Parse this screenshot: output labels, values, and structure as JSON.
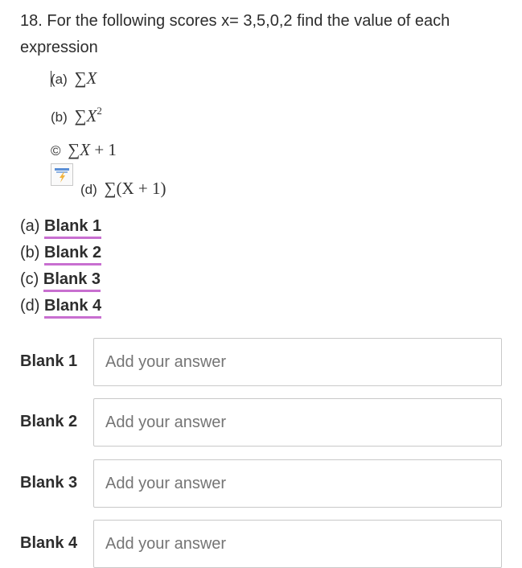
{
  "question": {
    "text": "18. For the following scores x= 3,5,0,2  find the value of each expression"
  },
  "expressions": [
    {
      "label": "(a)",
      "sum": "∑",
      "var": "X",
      "tail": ""
    },
    {
      "label": "(b)",
      "sum": "∑",
      "var": "X",
      "sup": "2",
      "tail": ""
    },
    {
      "label": "©",
      "sum": "∑",
      "var": "X",
      "tail": " + 1"
    },
    {
      "label": "(d)",
      "math": "∑(X + 1)"
    }
  ],
  "blank_refs": [
    {
      "prefix": "(a)",
      "blank": "Blank 1"
    },
    {
      "prefix": "(b)",
      "blank": "Blank 2"
    },
    {
      "prefix": "(c)",
      "blank": "Blank 3"
    },
    {
      "prefix": "(d)",
      "blank": "Blank 4"
    }
  ],
  "answers": [
    {
      "label": "Blank 1",
      "placeholder": "Add your answer",
      "value": ""
    },
    {
      "label": "Blank 2",
      "placeholder": "Add your answer",
      "value": ""
    },
    {
      "label": "Blank 3",
      "placeholder": "Add your answer",
      "value": ""
    },
    {
      "label": "Blank 4",
      "placeholder": "Add your answer",
      "value": ""
    }
  ],
  "colors": {
    "blank_underline": "#c86fd0",
    "input_border": "#c9c9c9"
  }
}
